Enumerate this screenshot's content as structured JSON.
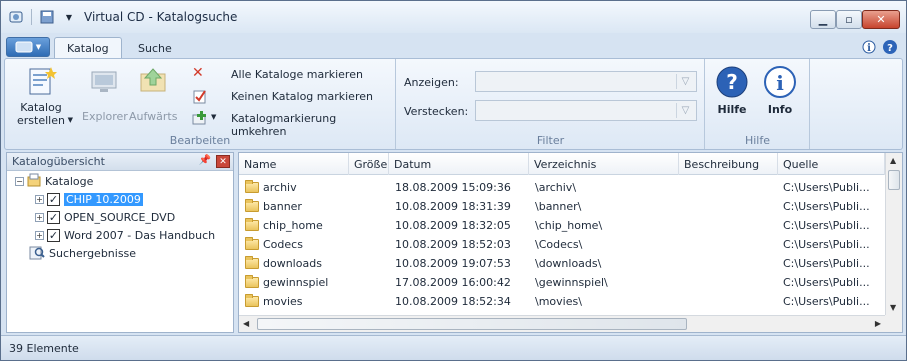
{
  "window": {
    "title": "Virtual CD - Katalogsuche"
  },
  "tabs": [
    {
      "label": "Katalog"
    },
    {
      "label": "Suche"
    }
  ],
  "ribbon": {
    "bearbeiten": {
      "label": "Bearbeiten",
      "katalog_erstellen": "Katalog\nerstellen",
      "explorer": "Explorer",
      "aufwaerts": "Aufwärts",
      "alle_markieren": "Alle Kataloge markieren",
      "keinen_markieren": "Keinen Katalog markieren",
      "umkehren": "Katalogmarkierung umkehren"
    },
    "filter": {
      "label": "Filter",
      "anzeigen_label": "Anzeigen:",
      "verstecken_label": "Verstecken:",
      "anzeigen_value": "",
      "verstecken_value": ""
    },
    "hilfe": {
      "label": "Hilfe",
      "hilfe_btn": "Hilfe",
      "info_btn": "Info"
    }
  },
  "catalog_panel": {
    "title": "Katalogübersicht",
    "root": "Kataloge",
    "catalogs": [
      {
        "name": "CHIP 10.2009",
        "checked": true,
        "selected": true
      },
      {
        "name": "OPEN_SOURCE_DVD",
        "checked": true,
        "selected": false
      },
      {
        "name": "Word 2007 - Das Handbuch",
        "checked": true,
        "selected": false
      }
    ],
    "search_results": "Suchergebnisse"
  },
  "file_list": {
    "columns": [
      "Name",
      "Größe",
      "Datum",
      "Verzeichnis",
      "Beschreibung",
      "Quelle"
    ],
    "rows": [
      {
        "name": "archiv",
        "size": "",
        "date": "18.08.2009 15:09:36",
        "dir": "\\archiv\\",
        "desc": "",
        "source": "C:\\Users\\Publi..."
      },
      {
        "name": "banner",
        "size": "",
        "date": "10.08.2009 18:31:39",
        "dir": "\\banner\\",
        "desc": "",
        "source": "C:\\Users\\Publi..."
      },
      {
        "name": "chip_home",
        "size": "",
        "date": "10.08.2009 18:32:05",
        "dir": "\\chip_home\\",
        "desc": "",
        "source": "C:\\Users\\Publi..."
      },
      {
        "name": "Codecs",
        "size": "",
        "date": "10.08.2009 18:52:03",
        "dir": "\\Codecs\\",
        "desc": "",
        "source": "C:\\Users\\Publi..."
      },
      {
        "name": "downloads",
        "size": "",
        "date": "10.08.2009 19:07:53",
        "dir": "\\downloads\\",
        "desc": "",
        "source": "C:\\Users\\Publi..."
      },
      {
        "name": "gewinnspiel",
        "size": "",
        "date": "17.08.2009 16:00:42",
        "dir": "\\gewinnspiel\\",
        "desc": "",
        "source": "C:\\Users\\Publi..."
      },
      {
        "name": "movies",
        "size": "",
        "date": "10.08.2009 18:52:34",
        "dir": "\\movies\\",
        "desc": "",
        "source": "C:\\Users\\Publi..."
      }
    ]
  },
  "status": {
    "text": "39 Elemente"
  }
}
